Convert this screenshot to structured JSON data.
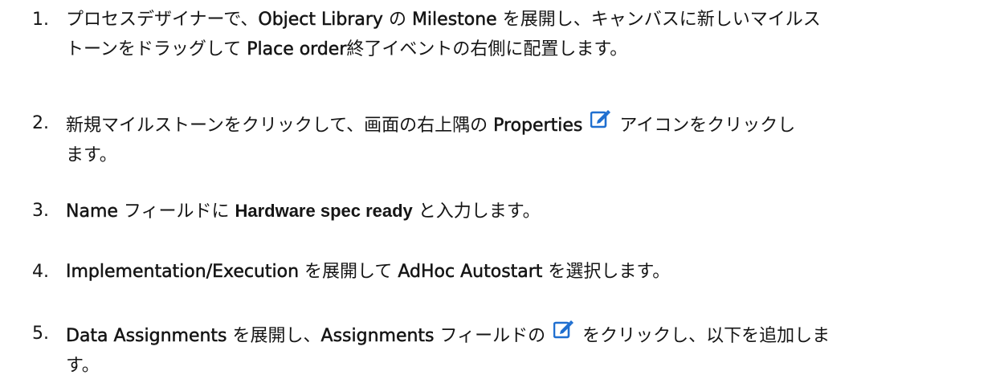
{
  "steps": [
    {
      "number": "1.",
      "line1_a": "プロセスデザイナーで、",
      "line1_b": "Object Library",
      "line1_c": " の ",
      "line1_d": "Milestone",
      "line1_e": " を展開し、キャンバスに新しいマイルス",
      "line2_a": "トーンをドラッグして ",
      "line2_b": "Place order",
      "line2_c": "終了イベントの右側に配置します。"
    },
    {
      "number": "2.",
      "line1_a": "新規マイルストーンをクリックして、画面の右上隅の ",
      "line1_b": "Properties",
      "line1_c": "アイコンをクリックし",
      "line2_a": "ます。",
      "icon": "edit-icon"
    },
    {
      "number": "3.",
      "line1_a": "Name",
      "line1_b": " フィールドに ",
      "line1_c": "Hardware spec ready",
      "line1_d": " と入力します。"
    },
    {
      "number": "4.",
      "line1_a": "Implementation/Execution",
      "line1_b": " を展開して ",
      "line1_c": "AdHoc Autostart",
      "line1_d": " を選択します。"
    },
    {
      "number": "5.",
      "line1_a": "Data Assignments",
      "line1_b": " を展開し、",
      "line1_c": "Assignments",
      "line1_d": " フィールドの",
      "line1_e": "をクリックし、以下を追加しま",
      "line2_a": "す。",
      "icon": "edit-icon"
    }
  ],
  "icon_color": "#1f6fd0"
}
